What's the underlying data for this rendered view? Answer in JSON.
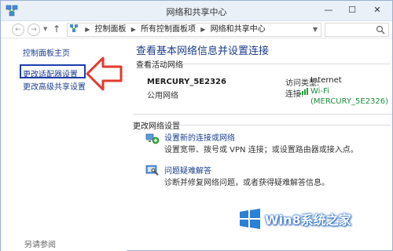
{
  "window": {
    "title": "网络和共享中心"
  },
  "address_bar": {
    "crumbs": [
      "控制面板",
      "所有控制面板项",
      "网络和共享中心"
    ]
  },
  "sidebar": {
    "home_link": "控制面板主页",
    "adapter_link": "更改适配器设置",
    "sharing_link": "更改高级共享设置",
    "see_also": "另请参阅"
  },
  "main": {
    "heading": "查看基本网络信息并设置连接",
    "active_networks_title": "查看活动网络",
    "network_name": "MERCURY_5E2326",
    "network_type": "公用网络",
    "access_type_label": "访问类型:",
    "access_type_value": "Internet",
    "connections_label": "连接:",
    "connection_line1": "Wi-Fi",
    "connection_line2": "(MERCURY_5E2326)",
    "change_settings_title": "更改网络设置",
    "tasks": [
      {
        "title": "设置新的连接或网络",
        "desc": "设置宽带、拨号或 VPN 连接；或设置路由器或接入点。",
        "icon": "network-setup-icon"
      },
      {
        "title": "问题疑难解答",
        "desc": "诊断并修复网络问题，或者获得疑难解答信息。",
        "icon": "troubleshoot-icon"
      }
    ]
  },
  "watermark": {
    "text": "Win8系统之家"
  },
  "colors": {
    "link": "#1a3f8f",
    "heading": "#1c3d8c",
    "connection_link": "#1e8e3e",
    "highlight_border": "#1e3fb0",
    "arrow": "#e23a2e"
  }
}
